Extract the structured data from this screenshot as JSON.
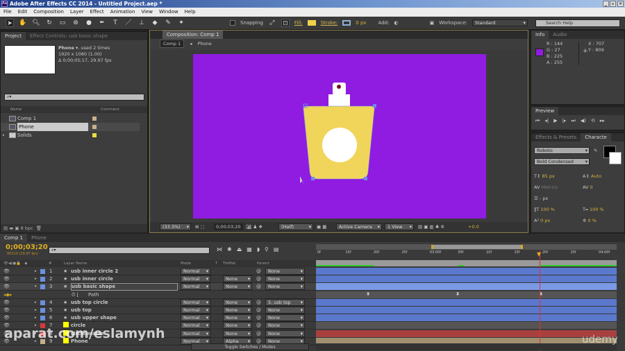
{
  "window": {
    "title": "Adobe After Effects CC 2014 - Untitled Project.aep *",
    "app_icon": "Ae",
    "min": "_",
    "restore": "▫",
    "close": "✕"
  },
  "menu": [
    "File",
    "Edit",
    "Composition",
    "Layer",
    "Effect",
    "Animation",
    "View",
    "Window",
    "Help"
  ],
  "toolbar": {
    "snapping": "Snapping",
    "fill": "Fill:",
    "fill_color": "#f0d24a",
    "stroke": "Stroke:",
    "stroke_px": "0 px",
    "add": "Add:",
    "workspace_label": "Workspace:",
    "workspace": "Standard",
    "search_placeholder": "Search Help"
  },
  "project": {
    "tab": "Project",
    "effect_tab": "Effect Controls: usb basic shape",
    "item_name": "Phone",
    "used": ", used 2 times",
    "dims": "1920 x 1080 (1.00)",
    "duration": "Δ 0;00;05;17, 29.97 fps",
    "col_name": "Name",
    "col_comment": "Comment",
    "items": [
      {
        "name": "Comp 1",
        "color": "#c8b08a",
        "type": "comp"
      },
      {
        "name": "Phone",
        "color": "#c8b08a",
        "type": "comp",
        "selected": true
      },
      {
        "name": "Solids",
        "color": "#e8e040",
        "type": "folder"
      }
    ],
    "bpc": "8 bpc"
  },
  "composition": {
    "tab": "Composition: Comp 1",
    "breadcrumb": [
      "Comp 1",
      "Phone"
    ],
    "bg_color": "#901be1",
    "zoom": "(33.3%)",
    "timecode": "0;00;03;20",
    "resolution": "(Half)",
    "camera": "Active Camera",
    "views": "1 View",
    "exposure": "+0.0"
  },
  "info": {
    "tab": "Info",
    "audio_tab": "Audio",
    "r": "R : 144",
    "g": "G : 27",
    "b": "B : 225",
    "a": "A : 255",
    "x": "X : 707",
    "y": "Y : 809",
    "color": "#901be1"
  },
  "preview": {
    "tab": "Preview"
  },
  "character": {
    "effects_tab": "Effects & Presets",
    "tab": "Characte",
    "font": "Roboto",
    "style": "Bold Condensed",
    "size": "85 px",
    "leading": "Auto",
    "kerning": "Metrics",
    "tracking": "0",
    "stroke_width": "- px",
    "vscale": "100 %",
    "hscale": "100 %",
    "baseline": "0 px",
    "tsume": "0 %"
  },
  "timeline": {
    "tabs": [
      "Comp 1",
      "Phone"
    ],
    "timecode": "0;00;03;20",
    "frames": "00110 (29.97 fps)",
    "headers": {
      "num": "#",
      "name": "Layer Name",
      "mode": "Mode",
      "t": "T",
      "trkmat": "TrkMat",
      "parent": "Parent"
    },
    "ruler": [
      "0f",
      "15f",
      "20f",
      "25f",
      "03:00f",
      "05f",
      "10f",
      "15f",
      "20f",
      "25f",
      "04:00f"
    ],
    "layers": [
      {
        "num": "1",
        "name": "usb inner circle 2",
        "color": "#6d8fe0",
        "mode": "Normal",
        "trkmat": "",
        "parent": "None",
        "star": true
      },
      {
        "num": "2",
        "name": "usb inner circle",
        "color": "#6d8fe0",
        "mode": "Normal",
        "trkmat": "None",
        "parent": "None",
        "star": true
      },
      {
        "num": "3",
        "name": "usb basic shape",
        "color": "#6d8fe0",
        "mode": "Normal",
        "trkmat": "None",
        "parent": "None",
        "star": true,
        "selected": true
      },
      {
        "num": "",
        "name": "Path",
        "sub": true
      },
      {
        "num": "4",
        "name": "usb top circle",
        "color": "#6d8fe0",
        "mode": "Normal",
        "trkmat": "None",
        "parent": "5. usb top",
        "star": true
      },
      {
        "num": "5",
        "name": "usb top",
        "color": "#6d8fe0",
        "mode": "Normal",
        "trkmat": "None",
        "parent": "None",
        "star": true
      },
      {
        "num": "6",
        "name": "usb upper shape",
        "color": "#6d8fe0",
        "mode": "Normal",
        "trkmat": "None",
        "parent": "None",
        "star": true
      },
      {
        "num": "7",
        "name": "circle",
        "color": "#d63a3a",
        "mode": "Normal",
        "trkmat": "None",
        "parent": "None"
      },
      {
        "num": "8",
        "name": "circle matte",
        "color": "#d63a3a",
        "mode": "Normal",
        "trkmat": "None",
        "parent": "None"
      },
      {
        "num": "9",
        "name": "Phone",
        "color": "#c8b08a",
        "mode": "Normal",
        "trkmat": "Alpha",
        "parent": "None"
      }
    ],
    "toggle": "Toggle Switches / Modes"
  },
  "watermarks": {
    "left": "aparat.com/eslamynh",
    "right": "udemy"
  }
}
